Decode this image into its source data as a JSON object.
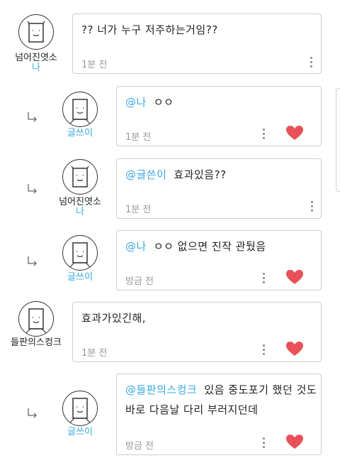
{
  "comments": [
    {
      "author": "넘어진엿소",
      "badge": "나",
      "text": "?? 너가 누구 저주하는거임??",
      "mention": "",
      "time": "1분 전",
      "liked": false,
      "is_reply": false
    },
    {
      "author": "글쓰이",
      "badge": "",
      "mention": "@나",
      "text": "ㅇㅇ",
      "time": "1분 전",
      "liked": true,
      "is_reply": true
    },
    {
      "author": "넘어진엿소",
      "badge": "나",
      "mention": "@글쓴이",
      "text": "효과있음??",
      "time": "1분 전",
      "liked": false,
      "is_reply": true
    },
    {
      "author": "글쓰이",
      "badge": "",
      "mention": "@나",
      "text": "ㅇㅇ 없으면 진작 관뒀음",
      "time": "방금 전",
      "liked": true,
      "is_reply": true
    },
    {
      "author": "들판의스컹크",
      "badge": "",
      "mention": "",
      "text": "효과가있긴해,",
      "time": "1분 전",
      "liked": true,
      "is_reply": false
    },
    {
      "author": "글쓰이",
      "badge": "",
      "mention": "@들판의스컹크",
      "text": "있음 중도포기 했던 것도",
      "text2": "바로 다음날 다리 부러지던데",
      "time": "방금 전",
      "liked": true,
      "is_reply": true
    }
  ],
  "icons": {
    "reply": "reply-arrow-icon",
    "more": "more-vertical-icon",
    "like": "heart-icon",
    "avatar": "paper-bag-face-icon"
  },
  "colors": {
    "accent": "#39a9e0",
    "heart": "#e8515a",
    "border": "#cfcfcf",
    "time": "#9a9a9a"
  }
}
